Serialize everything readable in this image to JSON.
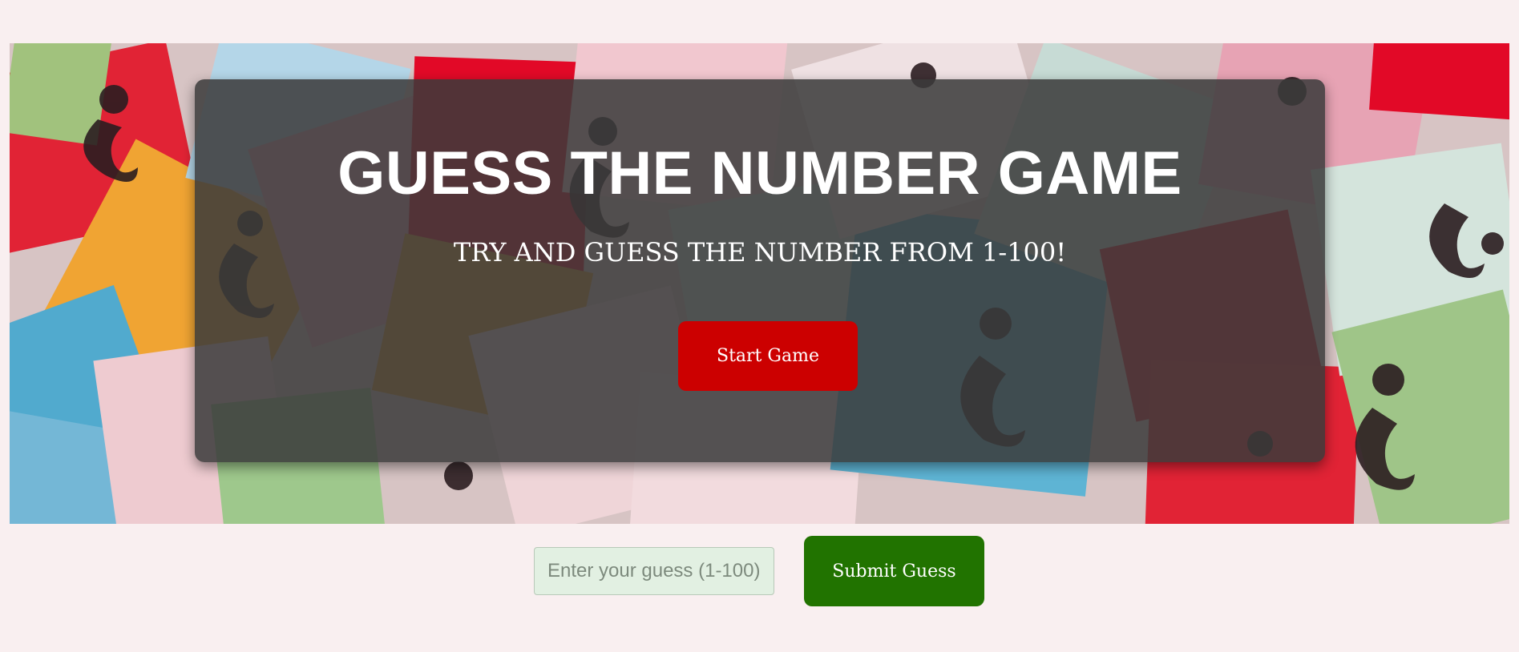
{
  "hero": {
    "title": "GUESS THE NUMBER GAME",
    "subtitle": "TRY AND GUESS THE NUMBER FROM 1-100!",
    "start_button_label": "Start Game",
    "background": "question-mark-paper-cards-image"
  },
  "guess": {
    "placeholder": "Enter your guess (1-100)",
    "value": "",
    "submit_button_label": "Submit Guess"
  },
  "colors": {
    "page_background": "#f9eff0",
    "start_button": "#cc0000",
    "submit_button": "#217300",
    "input_background": "#e2f0e2",
    "overlay": "#3a3a3a"
  }
}
